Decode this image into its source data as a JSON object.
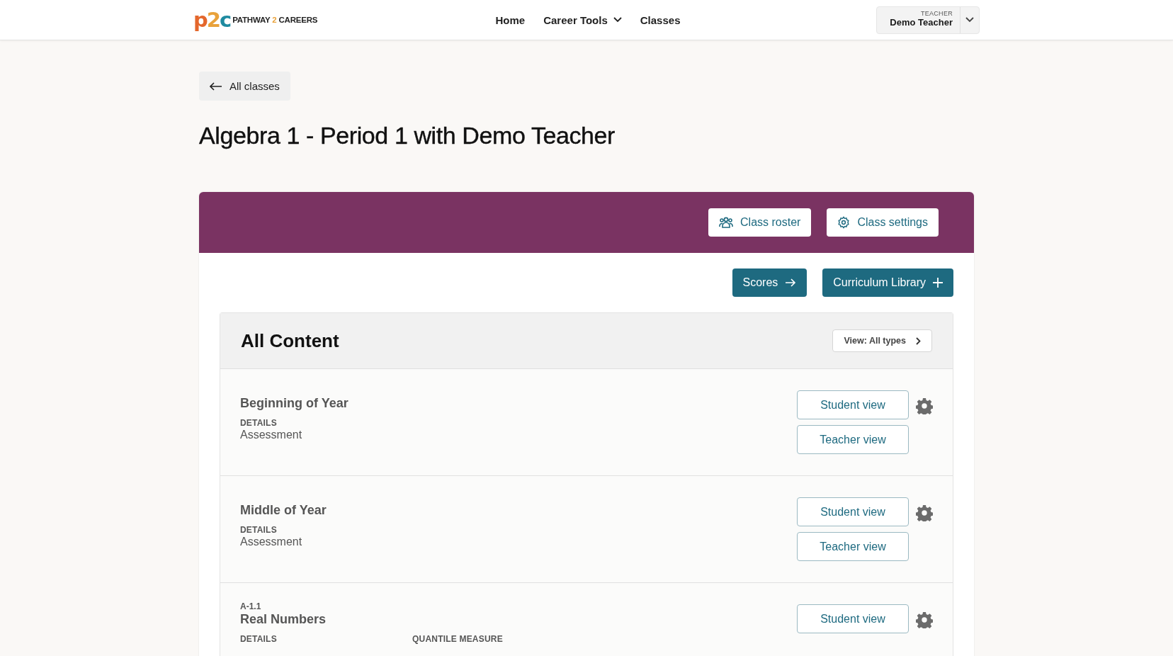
{
  "header": {
    "logo_mark": "p2c",
    "logo_words": [
      "PATHWAY",
      "2",
      "CAREERS"
    ],
    "nav": [
      {
        "label": "Home",
        "dropdown": false
      },
      {
        "label": "Career Tools",
        "dropdown": true
      },
      {
        "label": "Classes",
        "dropdown": false
      }
    ],
    "user": {
      "role": "TEACHER",
      "name": "Demo Teacher"
    }
  },
  "back_link": "All classes",
  "title": "Algebra 1 - Period 1 with Demo Teacher",
  "class_actions": [
    {
      "label": "Class roster",
      "kind": "roster"
    },
    {
      "label": "Class settings",
      "kind": "settings"
    }
  ],
  "primary_actions": [
    {
      "label": "Scores",
      "kind": "arrow"
    },
    {
      "label": "Curriculum Library",
      "kind": "plus"
    }
  ],
  "content": {
    "title": "All Content",
    "filter": "View: All types",
    "items": [
      {
        "title": "Beginning of Year",
        "fields": [
          {
            "label": "DETAILS",
            "value": "Assessment"
          }
        ],
        "buttons": [
          "Student view",
          "Teacher view"
        ]
      },
      {
        "title": "Middle of Year",
        "fields": [
          {
            "label": "DETAILS",
            "value": "Assessment"
          }
        ],
        "buttons": [
          "Student view",
          "Teacher view"
        ]
      },
      {
        "code": "A-1.1",
        "title": "Real Numbers",
        "fields": [
          {
            "label": "DETAILS"
          },
          {
            "label": "QUANTILE MEASURE"
          }
        ],
        "buttons": [
          "Student view"
        ]
      }
    ]
  }
}
